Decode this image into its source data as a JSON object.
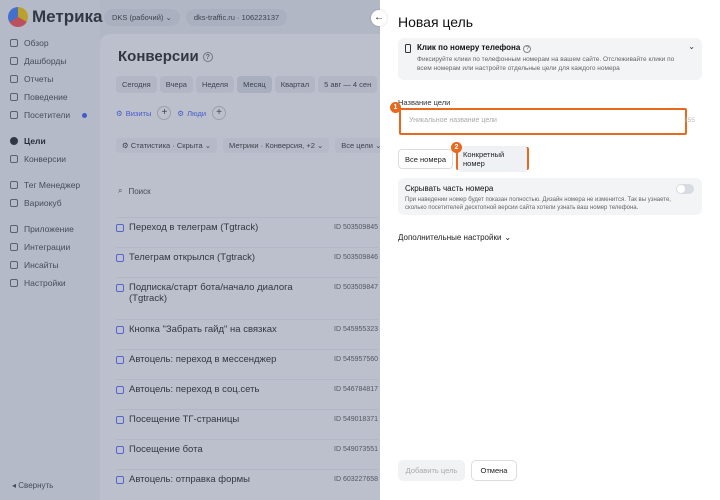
{
  "app": {
    "logo_text": "Метрика"
  },
  "sidebar": {
    "items": [
      {
        "label": "Обзор"
      },
      {
        "label": "Дашборды"
      },
      {
        "label": "Отчеты"
      },
      {
        "label": "Поведение"
      },
      {
        "label": "Посетители"
      },
      {
        "label": "Цели"
      },
      {
        "label": "Конверсии"
      },
      {
        "label": "Тег Менеджер"
      },
      {
        "label": "Вариокуб"
      },
      {
        "label": "Приложение"
      },
      {
        "label": "Интеграции"
      },
      {
        "label": "Инсайты"
      },
      {
        "label": "Настройки"
      }
    ],
    "collapse_label": "Свернуть"
  },
  "topbar": {
    "counter_name": "DKS (рабочий)",
    "site": "dks-traffic.ru",
    "counter_id": "106223137"
  },
  "main": {
    "title": "Конверсии",
    "periods": [
      "Сегодня",
      "Вчера",
      "Неделя",
      "Месяц",
      "Квартал",
      "5 авг — 4 сен"
    ],
    "segments": [
      {
        "label": "Визиты"
      },
      {
        "label": "Люди"
      }
    ],
    "filters": [
      "Статистика · Скрыта",
      "Метрики · Конверсия, +2",
      "Все цели"
    ],
    "search_label": "Поиск",
    "goals": [
      {
        "name": "Переход в телеграм (Tgtrack)",
        "id": "ID 503509845"
      },
      {
        "name": "Телеграм открылся (Tgtrack)",
        "id": "ID 503509846"
      },
      {
        "name": "Подписка/старт бота/начало диалога (Tgtrack)",
        "id": "ID 503509847"
      },
      {
        "name": "Кнопка \"Забрать гайд\" на связках",
        "id": "ID 545955323"
      },
      {
        "name": "Автоцель: переход в мессенджер",
        "id": "ID 545957560"
      },
      {
        "name": "Автоцель: переход в соц.сеть",
        "id": "ID 546784817"
      },
      {
        "name": "Посещение ТГ-страницы",
        "id": "ID 549018371"
      },
      {
        "name": "Посещение бота",
        "id": "ID 549073551"
      },
      {
        "name": "Автоцель: отправка формы",
        "id": "ID 603227658"
      }
    ]
  },
  "dialog": {
    "title": "Новая цель",
    "goal_type": {
      "title": "Клик по номеру телефона",
      "description": "Фиксируйте клики по телефонным номерам на вашем сайте. Отслеживайте клики по всем номерам или настройте отдельные цели для каждого номера"
    },
    "name_field": {
      "label": "Название цели",
      "placeholder": "Уникальное название цели",
      "value": "",
      "max_length": "255"
    },
    "modes": {
      "all_label": "Все номера",
      "specific_label": "Конкретный номер"
    },
    "hide_number": {
      "title": "Скрывать часть номера",
      "description": "При наведении номер будет показан полностью. Дизайн номера не изменится. Так вы узнаете, сколько посетителей десктопной версии сайта хотели узнать ваш номер телефона.",
      "enabled": false
    },
    "advanced_label": "Дополнительные настройки",
    "add_button": "Добавить цель",
    "cancel_button": "Отмена"
  },
  "markers": [
    "1",
    "2"
  ],
  "colors": {
    "highlight": "#e8681e",
    "accent": "#3d5cff"
  }
}
